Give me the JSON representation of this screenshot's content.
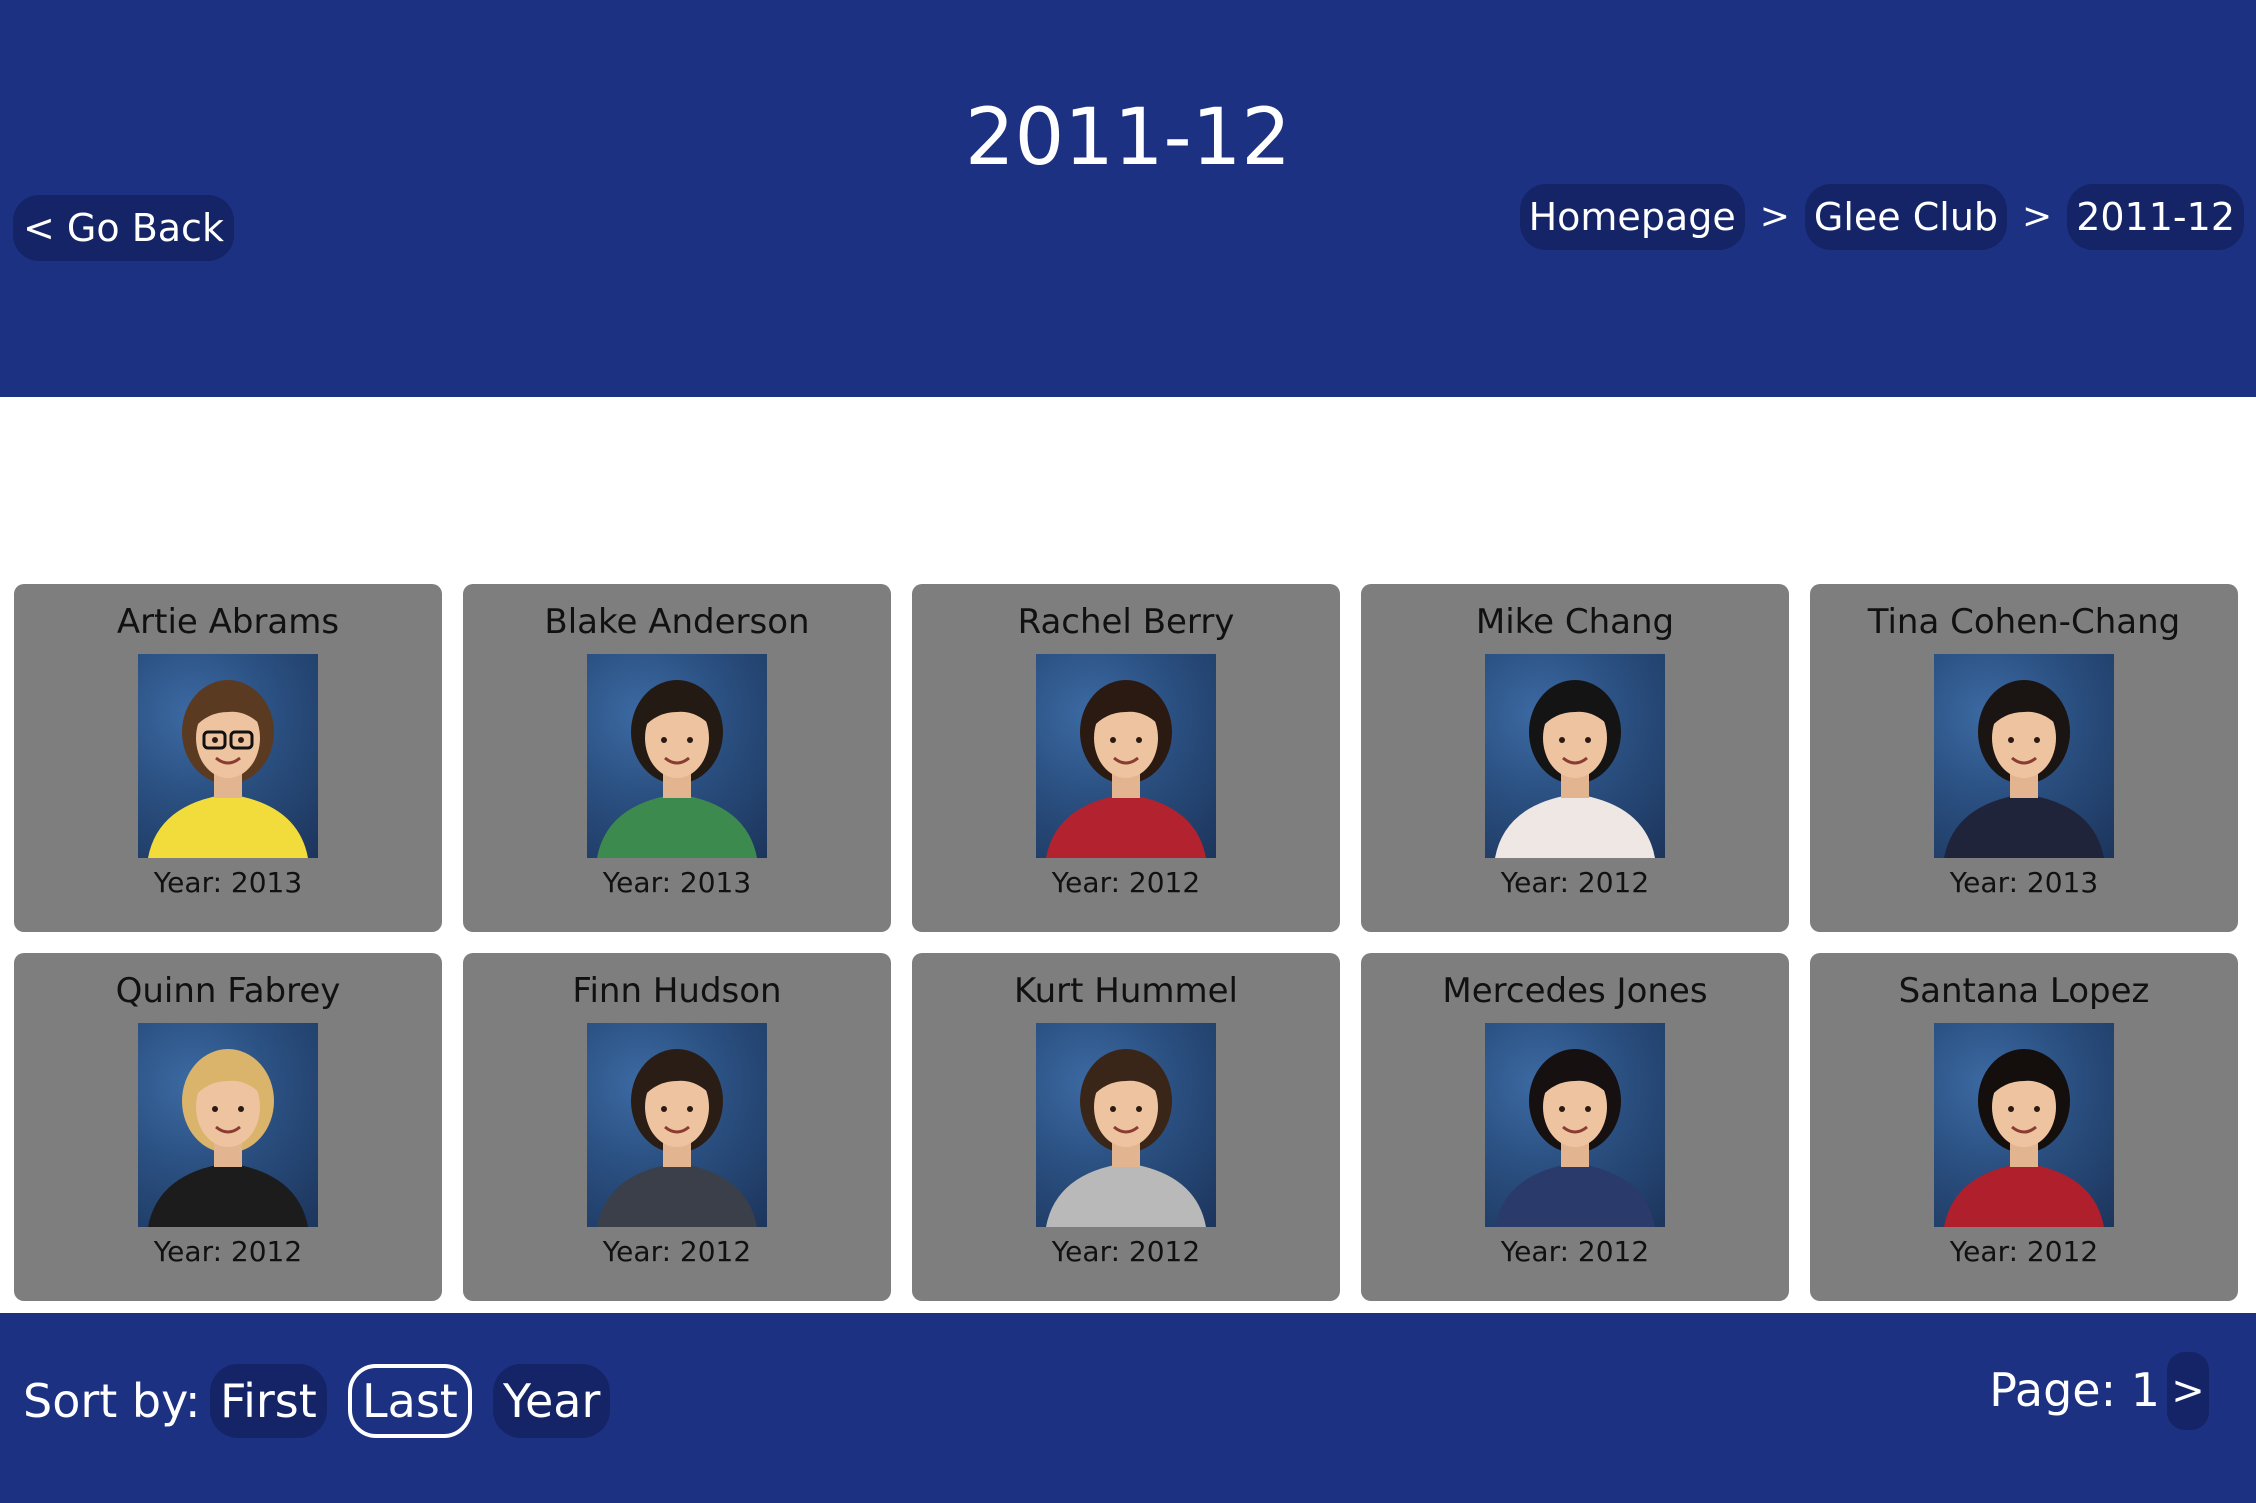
{
  "header": {
    "title": "2011-12",
    "go_back": "< Go Back",
    "breadcrumb": [
      {
        "label": "Homepage"
      },
      {
        "label": "Glee Club"
      },
      {
        "label": "2011-12"
      }
    ],
    "separator": ">"
  },
  "members": [
    {
      "name": "Artie Abrams",
      "year": "Year: 2013",
      "photo": {
        "hair": "#5b3a22",
        "shirt": "#f2dc3c",
        "glasses": true
      }
    },
    {
      "name": "Blake Anderson",
      "year": "Year: 2013",
      "photo": {
        "hair": "#241a14",
        "shirt": "#3d8a4f",
        "glasses": false
      }
    },
    {
      "name": "Rachel Berry",
      "year": "Year: 2012",
      "photo": {
        "hair": "#2b1a12",
        "shirt": "#b3232f",
        "glasses": false
      }
    },
    {
      "name": "Mike Chang",
      "year": "Year: 2012",
      "photo": {
        "hair": "#141414",
        "shirt": "#efe7e4",
        "glasses": false
      }
    },
    {
      "name": "Tina Cohen-Chang",
      "year": "Year: 2013",
      "photo": {
        "hair": "#1a1412",
        "shirt": "#20243a",
        "glasses": false
      }
    },
    {
      "name": "Quinn Fabrey",
      "year": "Year: 2012",
      "photo": {
        "hair": "#d9b46a",
        "shirt": "#1c1c1c",
        "glasses": false
      }
    },
    {
      "name": "Finn Hudson",
      "year": "Year: 2012",
      "photo": {
        "hair": "#2a1d15",
        "shirt": "#3a3f4a",
        "glasses": false
      }
    },
    {
      "name": "Kurt Hummel",
      "year": "Year: 2012",
      "photo": {
        "hair": "#3a2618",
        "shirt": "#b9b9b9",
        "glasses": false
      }
    },
    {
      "name": "Mercedes Jones",
      "year": "Year: 2012",
      "photo": {
        "hair": "#161010",
        "shirt": "#2a3a6a",
        "glasses": false
      }
    },
    {
      "name": "Santana Lopez",
      "year": "Year: 2012",
      "photo": {
        "hair": "#140e0c",
        "shirt": "#b01f2c",
        "glasses": false
      }
    }
  ],
  "footer": {
    "sort_label": "Sort by:",
    "sort_options": [
      {
        "label": "First",
        "active": false
      },
      {
        "label": "Last",
        "active": true
      },
      {
        "label": "Year",
        "active": false
      }
    ],
    "page_label": "Page: 1",
    "next": ">"
  },
  "colors": {
    "header_bg": "#1c3181",
    "button_bg": "#142466",
    "card_bg": "#7e7e7e"
  }
}
